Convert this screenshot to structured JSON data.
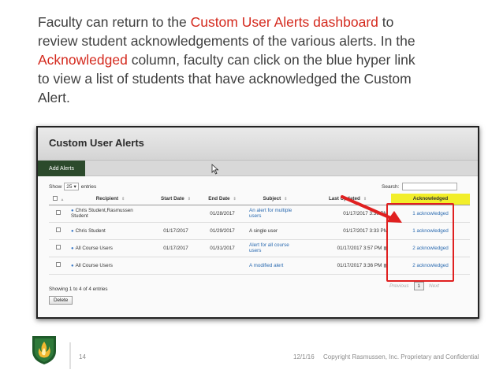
{
  "intro": {
    "line1_a": "Faculty can return to the ",
    "line1_hl": "Custom User Alerts dashboard",
    "line1_b": " to",
    "line2": "review student acknowledgements of the various alerts. In the",
    "line3_hl": "Acknowledged",
    "line3_b": " column, faculty can click on the blue hyper link",
    "line4": "to view a list of students that have acknowledged the Custom",
    "line5": "Alert."
  },
  "screenshot": {
    "title": "Custom User Alerts",
    "add_alerts_label": "Add Alerts",
    "show_label": "Show",
    "entries_value": "25",
    "entries_label": "entries",
    "search_label": "Search:",
    "columns": [
      "Recipient",
      "Start Date",
      "End Date",
      "Subject",
      "Last Updated",
      "Acknowledged"
    ],
    "rows": [
      {
        "recipient": "Chris Student,Rasmussen Student",
        "start": "",
        "end": "01/28/2017",
        "subject": "An alert for multiple users",
        "updated": "01/17/2017 3:36 PM",
        "ack": "1 acknowledged"
      },
      {
        "recipient": "Chris Student",
        "start": "01/17/2017",
        "end": "01/29/2017",
        "subject": "A single user",
        "updated": "01/17/2017 3:33 PM",
        "ack": "1 acknowledged"
      },
      {
        "recipient": "All Course Users",
        "start": "01/17/2017",
        "end": "01/31/2017",
        "subject": "Alert for all course users",
        "updated": "01/17/2017 3:57 PM",
        "ack": "2 acknowledged"
      },
      {
        "recipient": "All Course Users",
        "start": "",
        "end": "",
        "subject": "A modified alert",
        "updated": "01/17/2017 3:36 PM",
        "ack": "2 acknowledged"
      }
    ],
    "showing_text": "Showing 1 to 4 of 4 entries",
    "delete_label": "Delete",
    "pager": {
      "previous": "Previous",
      "page": "1",
      "next": "Next"
    }
  },
  "footer": {
    "slide_number": "14",
    "date": "12/1/16",
    "copyright": "Copyright Rasmussen, Inc. Proprietary and Confidential"
  },
  "colors": {
    "highlight_text": "#d42a1e",
    "add_alerts_bg": "#2c4a2c",
    "ack_header_bg": "#f2ee2a",
    "annotation_red": "#e02020",
    "link_blue": "#2a6ab0"
  }
}
